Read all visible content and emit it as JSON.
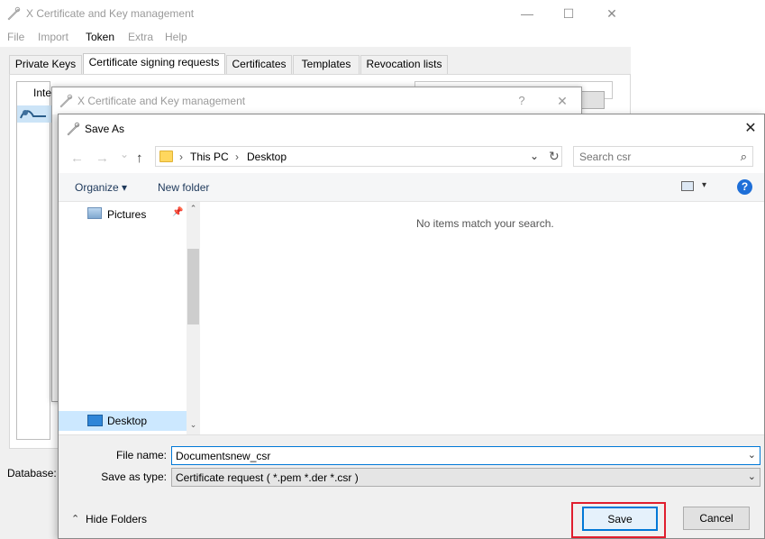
{
  "main_window": {
    "title": "X Certificate and Key management",
    "controls": {
      "minimize": "—",
      "maximize": "☐",
      "close": "✕"
    },
    "menu": [
      "File",
      "Import",
      "Token",
      "Extra",
      "Help"
    ],
    "tabs": [
      "Private Keys",
      "Certificate signing requests",
      "Certificates",
      "Templates",
      "Revocation lists"
    ],
    "list_header": "Inte",
    "database_label": "Database: C"
  },
  "middle_dialog": {
    "title": "X Certificate and Key management",
    "help": "?",
    "close": "✕"
  },
  "save_as": {
    "title": "Save As",
    "close": "✕",
    "nav": {
      "back": "←",
      "forward": "→",
      "recent": "⌄",
      "up": "↑"
    },
    "breadcrumb": [
      "This PC",
      "Desktop"
    ],
    "breadcrumb_sep": "›",
    "address_dropdown": "⌄",
    "refresh": "↻",
    "search_placeholder": "Search csr",
    "search_icon": "⌕",
    "organize_label": "Organize ▾",
    "new_folder_label": "New folder",
    "view_dropdown": "▾",
    "help": "?",
    "nav_items": {
      "pictures": "Pictures",
      "desktop": "Desktop",
      "pin": "📌"
    },
    "scroll_up": "⌃",
    "scroll_down": "⌄",
    "empty_message": "No items match your search.",
    "file_name_label": "File name:",
    "file_name_value": "Documentsnew_csr",
    "save_as_type_label": "Save as type:",
    "save_as_type_value": "Certificate request ( *.pem *.der *.csr )",
    "combo_arrow": "⌄",
    "hide_folders_label": "Hide Folders",
    "hide_folders_chevron": "⌃",
    "save_label": "Save",
    "cancel_label": "Cancel"
  },
  "colors": {
    "highlight_box": "#e01e2e",
    "accent": "#0078d7",
    "selection": "#cce8ff"
  }
}
